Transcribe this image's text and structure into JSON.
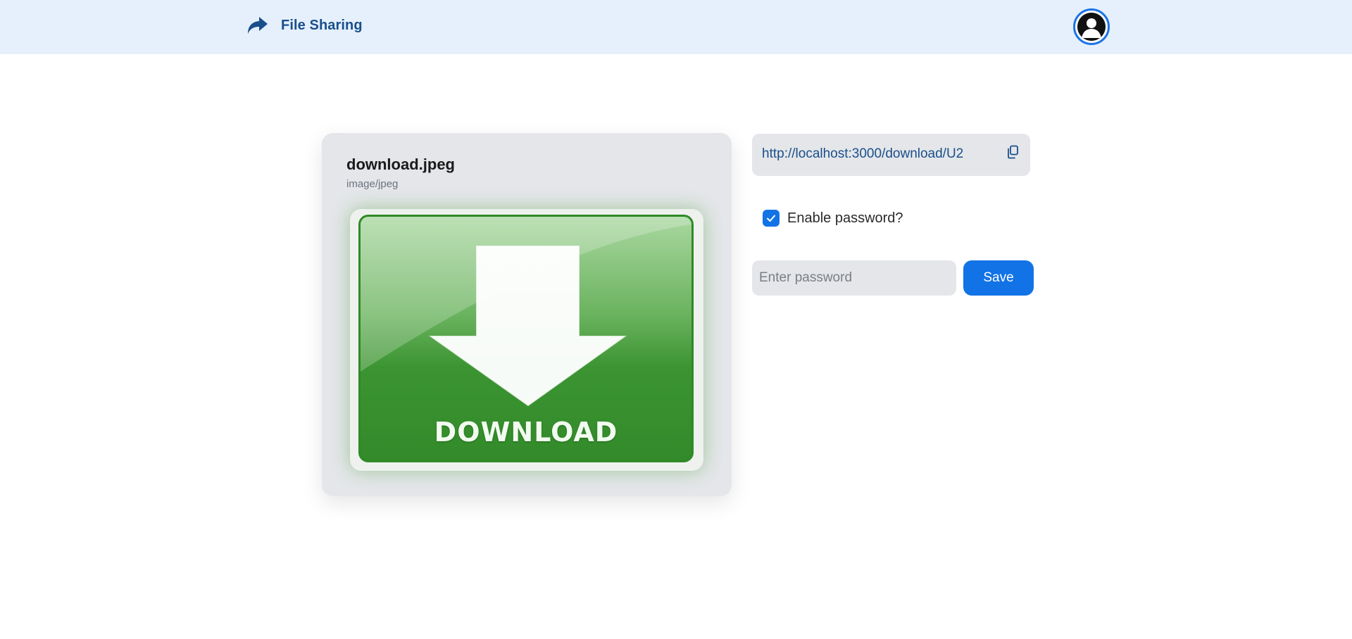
{
  "header": {
    "app_title": "File Sharing",
    "logo_icon": "share-arrow-icon",
    "avatar_icon": "user-avatar-icon",
    "background": "#e5f0fc",
    "accent": "#1a4f8b"
  },
  "file": {
    "name": "download.jpeg",
    "mime_type": "image/jpeg",
    "preview_text": "DOWNLOAD",
    "preview_icon": "download-arrow-icon"
  },
  "share": {
    "link": "http://localhost:3000/download/U2",
    "copy_icon": "copy-icon",
    "password_toggle_label": "Enable password?",
    "password_enabled": true,
    "password_placeholder": "Enter password",
    "password_value": "",
    "save_label": "Save"
  },
  "colors": {
    "primary": "#1273e6",
    "card": "#e4e6e9",
    "link": "#1a4f8b"
  }
}
